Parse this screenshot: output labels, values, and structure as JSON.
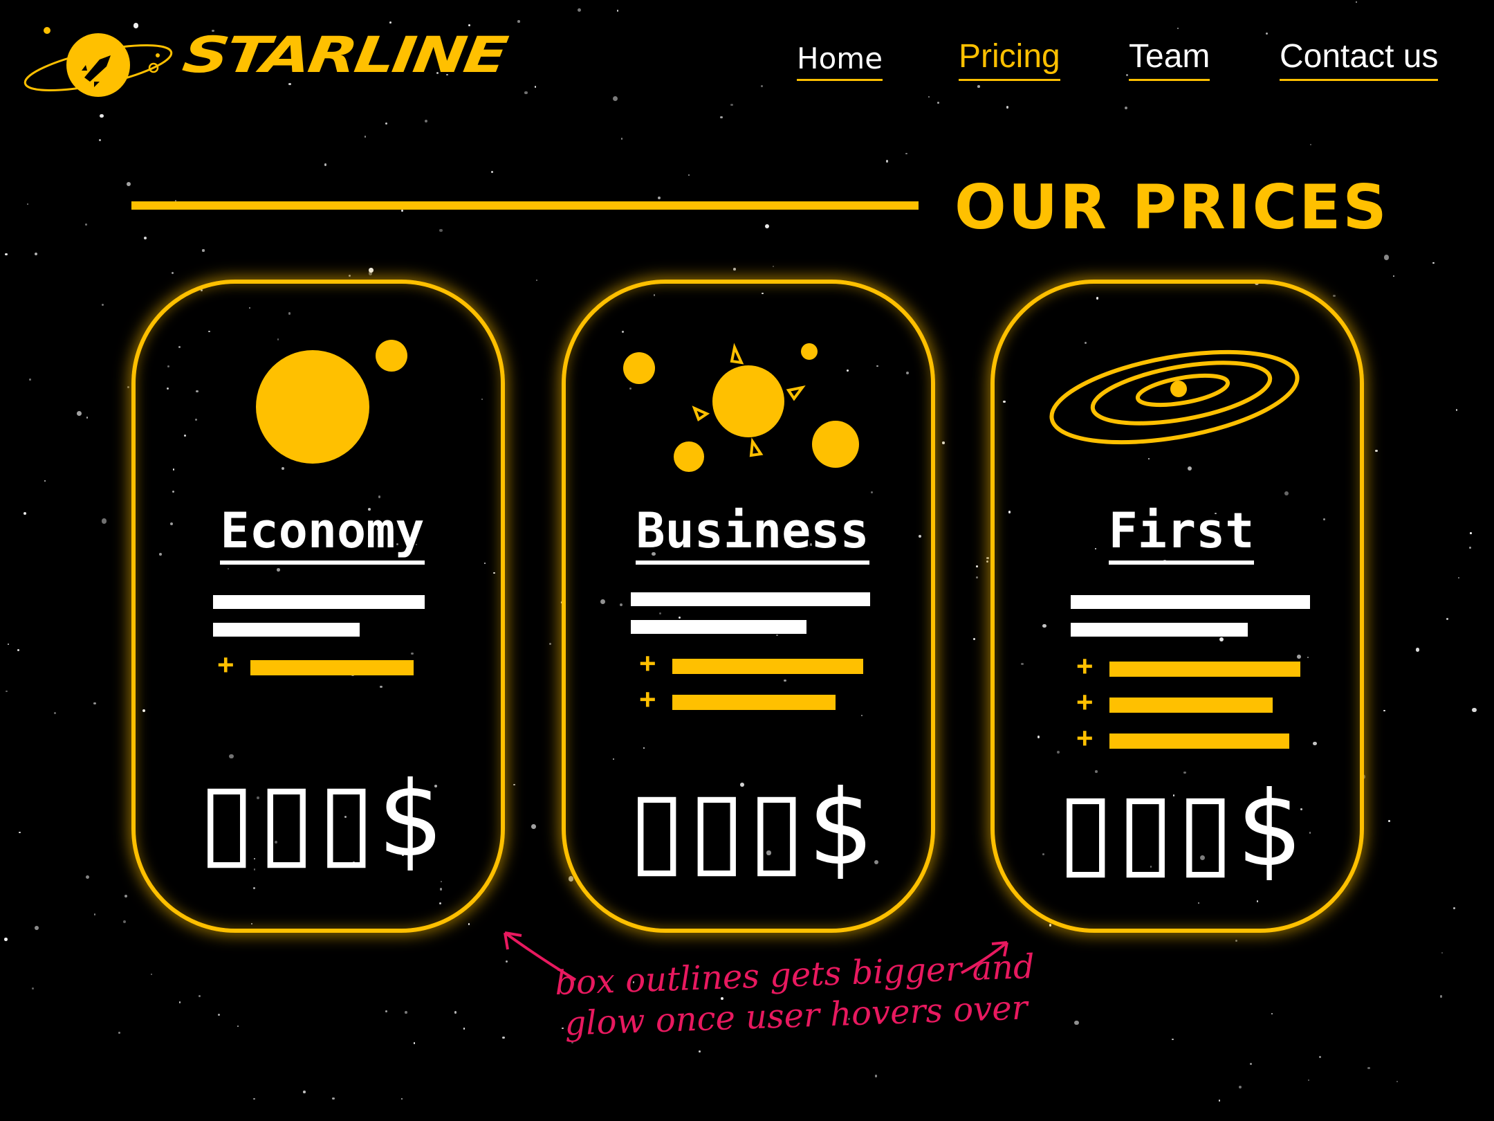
{
  "brand": {
    "name": "STARLINE"
  },
  "nav": {
    "home": "Home",
    "pricing": "Pricing",
    "team": "Team",
    "contact": "Contact us"
  },
  "heading": "OUR PRICES",
  "cards": [
    {
      "title": "Economy",
      "price": "▯▯▯$",
      "features": 1
    },
    {
      "title": "Business",
      "price": "▯▯▯$",
      "features": 2
    },
    {
      "title": "First",
      "price": "▯▯▯$",
      "features": 3
    }
  ],
  "annotation": "box outlines gets bigger and glow once user hovers over",
  "colors": {
    "accent": "#FFC000",
    "background": "#000000",
    "text": "#FFFFFF",
    "annotation": "#E8195F"
  },
  "icons": {
    "logo": "planet-rocket-icon",
    "economy": "planet-moon-icon",
    "business": "sun-planets-icon",
    "first": "galaxy-icon"
  }
}
